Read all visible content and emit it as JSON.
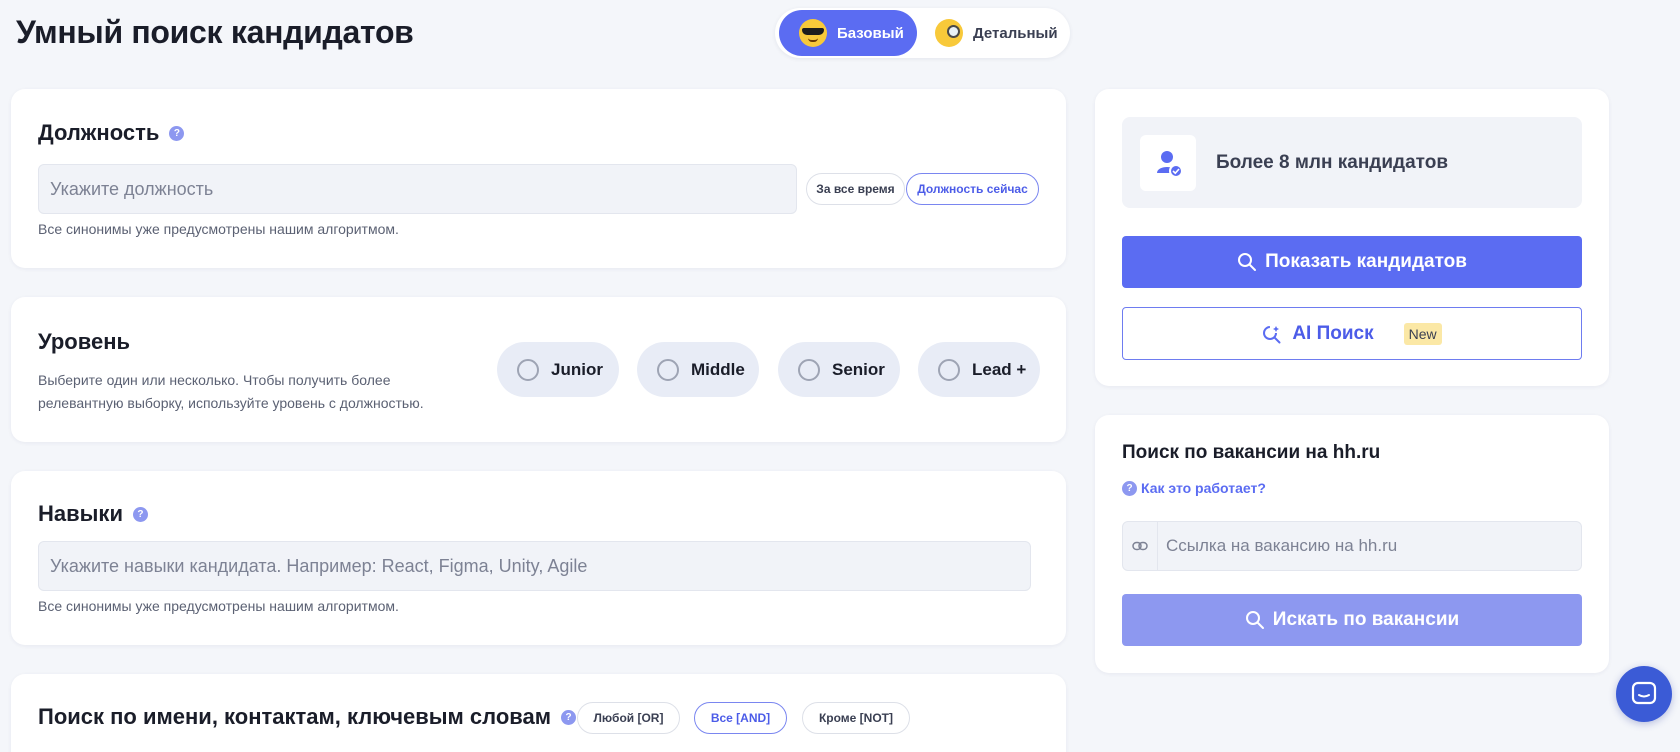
{
  "page": {
    "title": "Умный поиск кандидатов"
  },
  "mode_switch": {
    "basic_label": "Базовый",
    "detailed_label": "Детальный"
  },
  "position": {
    "title": "Должность",
    "help": "?",
    "placeholder": "Укажите должность",
    "toggle_all_time": "За все время",
    "toggle_current": "Должность сейчас",
    "hint": "Все синонимы уже предусмотрены нашим алгоритмом."
  },
  "level": {
    "title": "Уровень",
    "hint_line1": "Выберите один или несколько. Чтобы получить более",
    "hint_line2": "релевантную выборку, используйте уровень с должностью.",
    "options": [
      "Junior",
      "Middle",
      "Senior",
      "Lead +"
    ]
  },
  "skills": {
    "title": "Навыки",
    "help": "?",
    "placeholder": "Укажите навыки кандидата. Например: React, Figma, Unity, Agile",
    "hint": "Все синонимы уже предусмотрены нашим алгоритмом."
  },
  "keyword_search": {
    "title": "Поиск по имени, контактам, ключевым словам",
    "help": "?",
    "modes": [
      "Любой [OR]",
      "Все [AND]",
      "Кроме [NOT]"
    ],
    "selected_mode": "Все [AND]"
  },
  "sidebar": {
    "stat": "Более 8 млн кандидатов",
    "show_button": "Показать кандидатов",
    "ai_button": "AI Поиск",
    "new_badge": "New"
  },
  "hh_search": {
    "title": "Поиск по вакансии на hh.ru",
    "how_link": "Как это работает?",
    "help": "?",
    "placeholder": "Ссылка на вакансию на hh.ru",
    "search_button": "Искать по вакансии"
  },
  "colors": {
    "accent": "#5b6cf2",
    "accent_light": "#8d98f0",
    "background": "#f4f6fa",
    "card": "#ffffff",
    "field": "#f1f3f8"
  }
}
